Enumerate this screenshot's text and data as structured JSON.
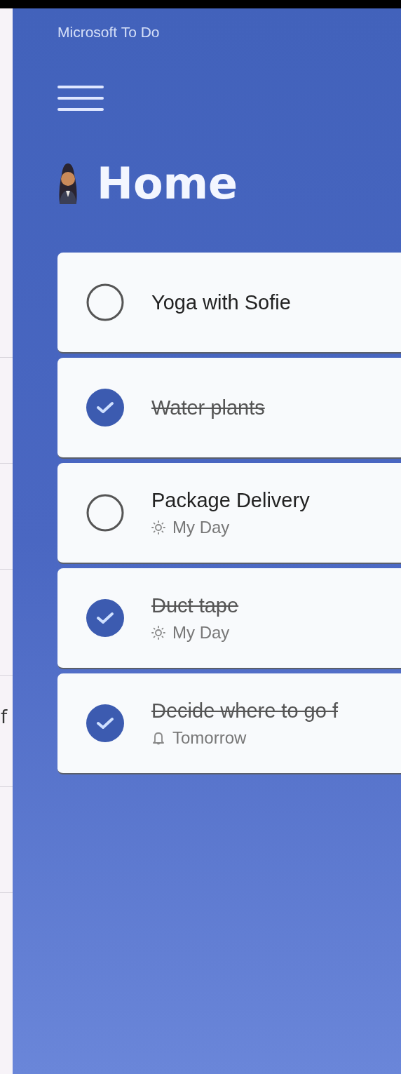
{
  "app_title": "Microsoft To Do",
  "side_strip": {
    "cut_text": "f"
  },
  "list": {
    "title": "Home"
  },
  "tasks": [
    {
      "title": "Yoga with Sofie",
      "completed": false
    },
    {
      "title": "Water plants",
      "completed": true
    },
    {
      "title": "Package Delivery",
      "completed": false,
      "meta": {
        "kind": "myday",
        "text": "My Day"
      }
    },
    {
      "title": "Duct tape",
      "completed": true,
      "meta": {
        "kind": "myday",
        "text": "My Day"
      }
    },
    {
      "title": "Decide where to go f",
      "completed": true,
      "meta": {
        "kind": "reminder",
        "text": "Tomorrow"
      }
    }
  ]
}
